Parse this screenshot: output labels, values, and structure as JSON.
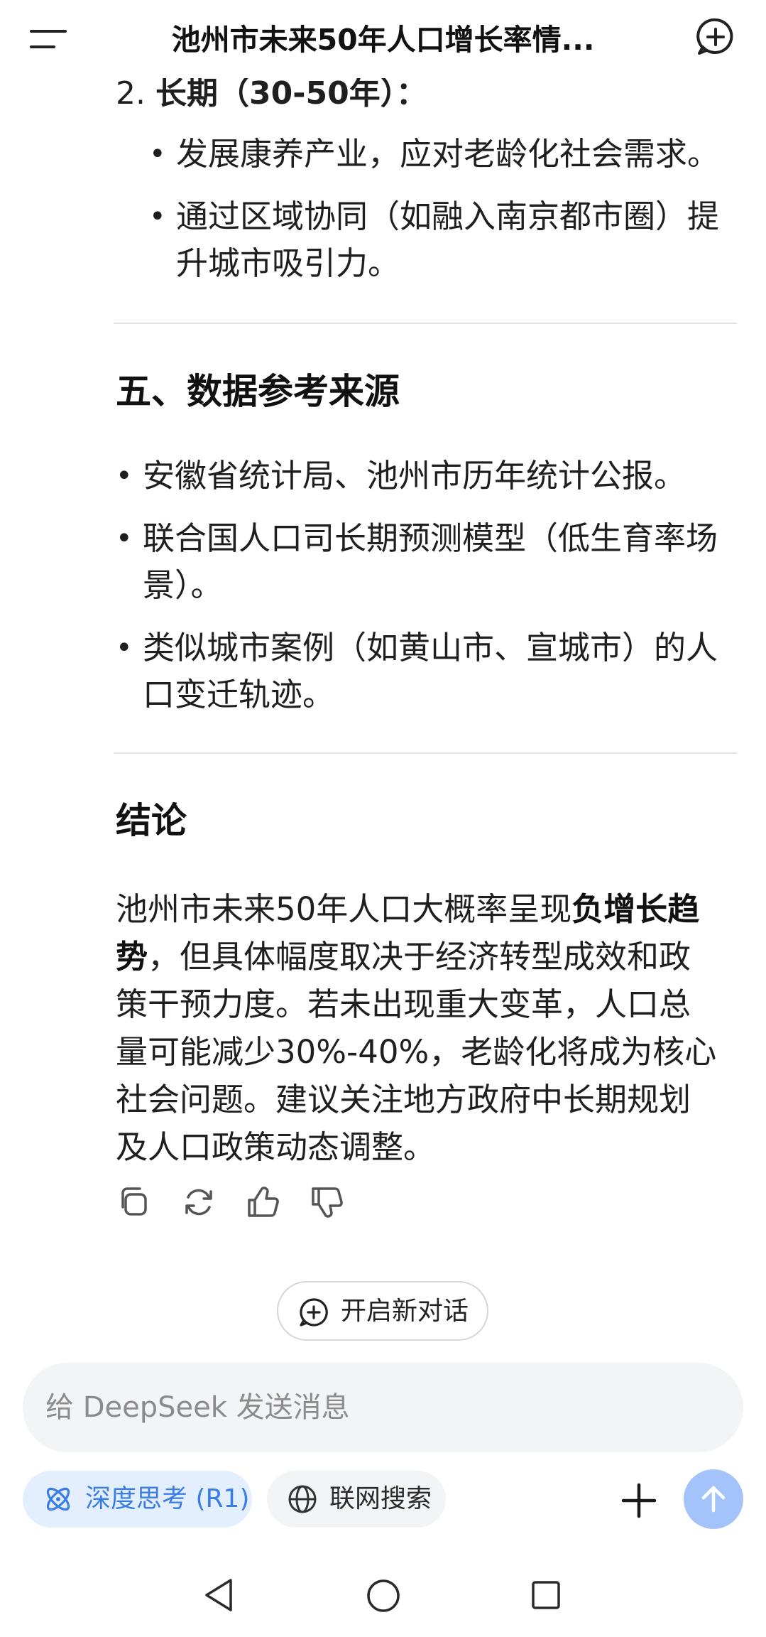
{
  "header": {
    "title": "池州市未来50年人口增长率情...",
    "menu_icon": "menu-icon",
    "new_chat_icon": "new-chat-icon"
  },
  "message": {
    "sub_point": {
      "number": "2.",
      "title": "长期（30-50年）："
    },
    "sub_bullets": [
      {
        "line1": "发展康养产业，应对老龄化社会需求。"
      },
      {
        "line1": "通过区域协同（如融入南京都市圈）提",
        "line2": "升城市吸引力。"
      }
    ],
    "section5": {
      "title": "五、数据参考来源",
      "bullets": [
        {
          "line1": "安徽省统计局、池州市历年统计公报。"
        },
        {
          "line1": "联合国人口司长期预测模型（低生育率场",
          "line2": "景）。"
        },
        {
          "line1": "类似城市案例（如黄山市、宣城市）的人",
          "line2": "口变迁轨迹。"
        }
      ]
    },
    "conclusion": {
      "title": "结论",
      "part1": "池州市未来50年人口大概率呈现",
      "bold1": "负增长趋",
      "bold2": "势",
      "part2": "，但具体幅度取决于经济转型成效和政",
      "line3": "策干预力度。若未出现重大变革，人口总",
      "line4": "量可能减少30%-40%，老龄化将成为核心",
      "line5": "社会问题。建议关注地方政府中长期规划",
      "line6": "及人口政策动态调整。"
    },
    "actions": [
      "copy-icon",
      "regenerate-icon",
      "thumbs-up-icon",
      "thumbs-down-icon"
    ]
  },
  "new_conversation": {
    "label": "开启新对话"
  },
  "input": {
    "placeholder": "给 DeepSeek 发送消息"
  },
  "toolbar": {
    "deep_think_label": "深度思考 (R1)",
    "web_search_label": "联网搜索",
    "accent_color": "#3b7de6",
    "send_color": "#a4c3fb"
  },
  "system_nav": [
    "back-icon",
    "home-icon",
    "recents-icon"
  ]
}
